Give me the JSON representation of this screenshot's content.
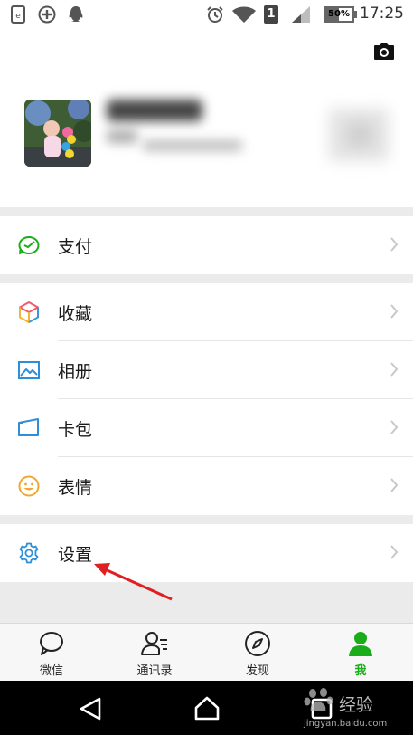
{
  "status_bar": {
    "time": "17:25",
    "battery": "50%",
    "sim_slot": "1",
    "icons": [
      "notification-icon",
      "add-circle-icon",
      "qq-icon",
      "alarm-icon",
      "wifi-icon",
      "sim-icon",
      "signal-icon",
      "battery-icon"
    ]
  },
  "header": {
    "camera_icon": "camera-icon"
  },
  "menu": {
    "pay": "支付",
    "favorites": "收藏",
    "album": "相册",
    "cards": "卡包",
    "stickers": "表情",
    "settings": "设置"
  },
  "tabs": [
    {
      "label": "微信",
      "icon": "chat-bubble-icon",
      "active": false
    },
    {
      "label": "通讯录",
      "icon": "contacts-icon",
      "active": false
    },
    {
      "label": "发现",
      "icon": "compass-icon",
      "active": false
    },
    {
      "label": "我",
      "icon": "person-icon",
      "active": true
    }
  ],
  "watermark": {
    "brand": "经验",
    "url": "jingyan.baidu.com"
  },
  "colors": {
    "accent_green": "#1aad19",
    "annotation_arrow": "#e02020",
    "nav_bar": "#000000",
    "section_gap": "#ebebeb"
  }
}
